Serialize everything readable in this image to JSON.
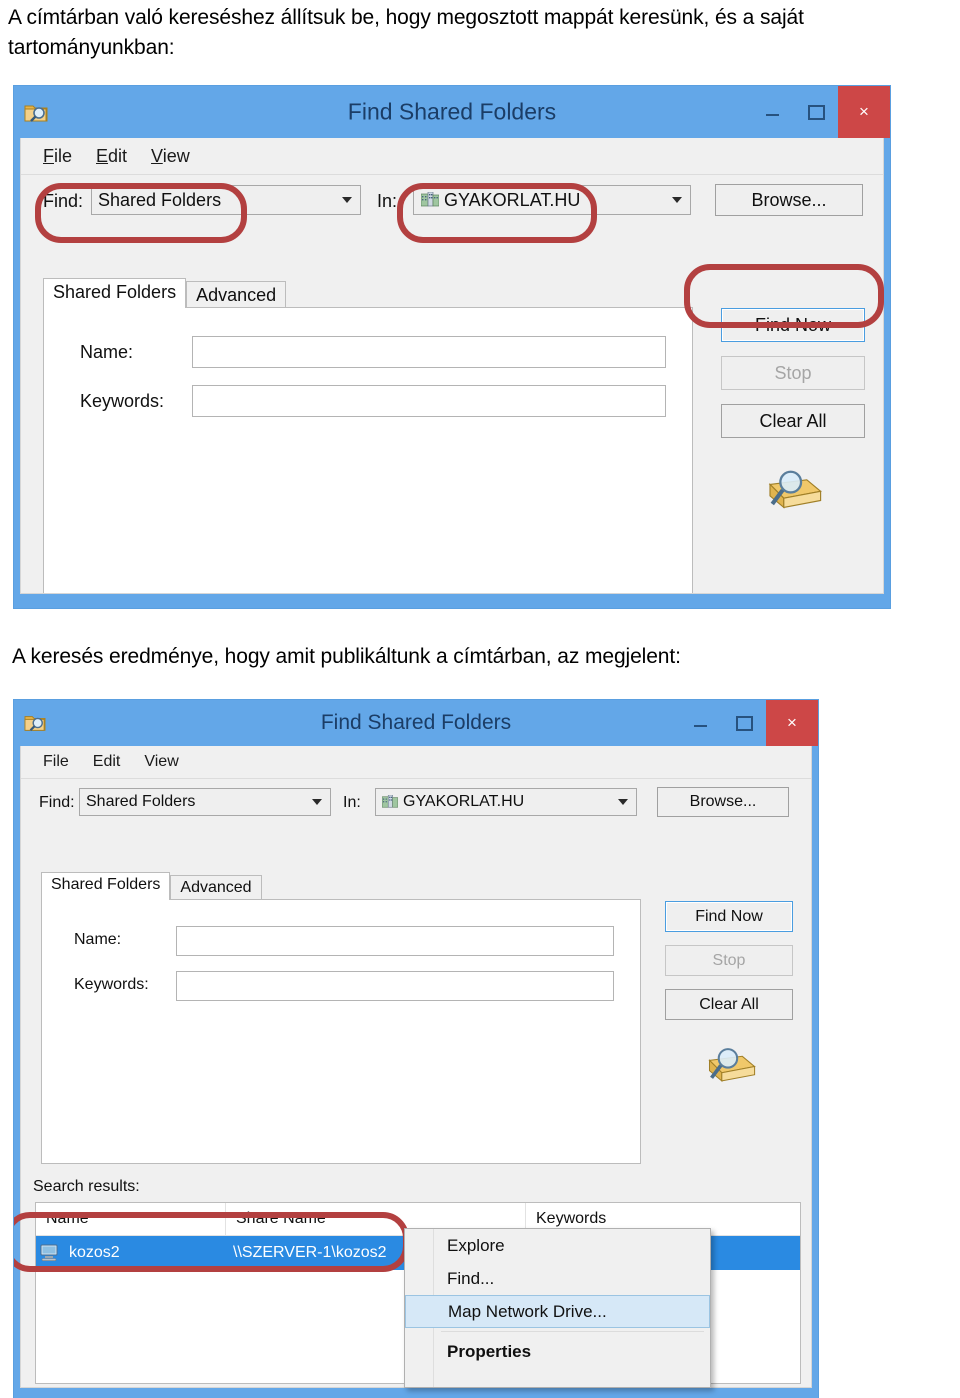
{
  "document": {
    "paragraph1": "A címtárban való kereséshez állítsuk be, hogy megosztott mappát keresünk, és a saját tartományunkban:",
    "paragraph2": "A keresés eredménye, hogy amit publikáltunk a címtárban, az megjelent:"
  },
  "colors": {
    "title_bar": "#63a7e8",
    "close_button": "#cd4747",
    "highlight_outline": "#b34040",
    "selection": "#2a8ae2",
    "menu_selection": "#d6e8f7",
    "dialog_face": "#f0f0f0"
  },
  "dialog1": {
    "title": "Find Shared Folders",
    "window_icon": "find-shared-folders-icon",
    "buttons": {
      "minimize": "minimize-icon",
      "maximize": "maximize-icon",
      "close": "×"
    },
    "menu": [
      {
        "label": "File",
        "accel": "F"
      },
      {
        "label": "Edit",
        "accel": "E"
      },
      {
        "label": "View",
        "accel": "V"
      }
    ],
    "find_label": "Find:",
    "find_value": "Shared Folders",
    "in_label": "In:",
    "in_value": "GYAKORLAT.HU",
    "browse_label": "Browse...",
    "tabs": [
      {
        "label": "Shared Folders",
        "active": true
      },
      {
        "label": "Advanced",
        "active": false
      }
    ],
    "fields": [
      {
        "label": "Name:",
        "value": ""
      },
      {
        "label": "Keywords:",
        "value": ""
      }
    ],
    "actions": [
      {
        "label": "Find Now",
        "state": "default"
      },
      {
        "label": "Stop",
        "state": "disabled"
      },
      {
        "label": "Clear All",
        "state": "normal"
      }
    ],
    "side_icon": "magnifier-folder-icon"
  },
  "dialog2": {
    "title": "Find Shared Folders",
    "window_icon": "find-shared-folders-icon",
    "buttons": {
      "minimize": "minimize-icon",
      "maximize": "maximize-icon",
      "close": "×"
    },
    "menu": [
      {
        "label": "File",
        "accel": ""
      },
      {
        "label": "Edit",
        "accel": ""
      },
      {
        "label": "View",
        "accel": ""
      }
    ],
    "find_label": "Find:",
    "find_value": "Shared Folders",
    "in_label": "In:",
    "in_value": "GYAKORLAT.HU",
    "browse_label": "Browse...",
    "tabs": [
      {
        "label": "Shared Folders",
        "active": true
      },
      {
        "label": "Advanced",
        "active": false
      }
    ],
    "fields": [
      {
        "label": "Name:",
        "value": ""
      },
      {
        "label": "Keywords:",
        "value": ""
      }
    ],
    "actions": [
      {
        "label": "Find Now",
        "state": "default"
      },
      {
        "label": "Stop",
        "state": "disabled"
      },
      {
        "label": "Clear All",
        "state": "normal"
      }
    ],
    "side_icon": "magnifier-folder-icon",
    "results_label": "Search results:",
    "results_columns": [
      "Name",
      "Share Name",
      "Keywords"
    ],
    "results_rows": [
      {
        "icon": "shared-folder-server-icon",
        "name": "kozos2",
        "share_name": "\\\\SZERVER-1\\kozos2",
        "keywords": "",
        "selected": true
      }
    ],
    "context_menu": [
      {
        "label": "Explore",
        "selected": false,
        "bold": false
      },
      {
        "label": "Find...",
        "selected": false,
        "bold": false
      },
      {
        "label": "Map Network Drive...",
        "selected": true,
        "bold": false
      },
      {
        "label": "Properties",
        "selected": false,
        "bold": true
      }
    ]
  }
}
